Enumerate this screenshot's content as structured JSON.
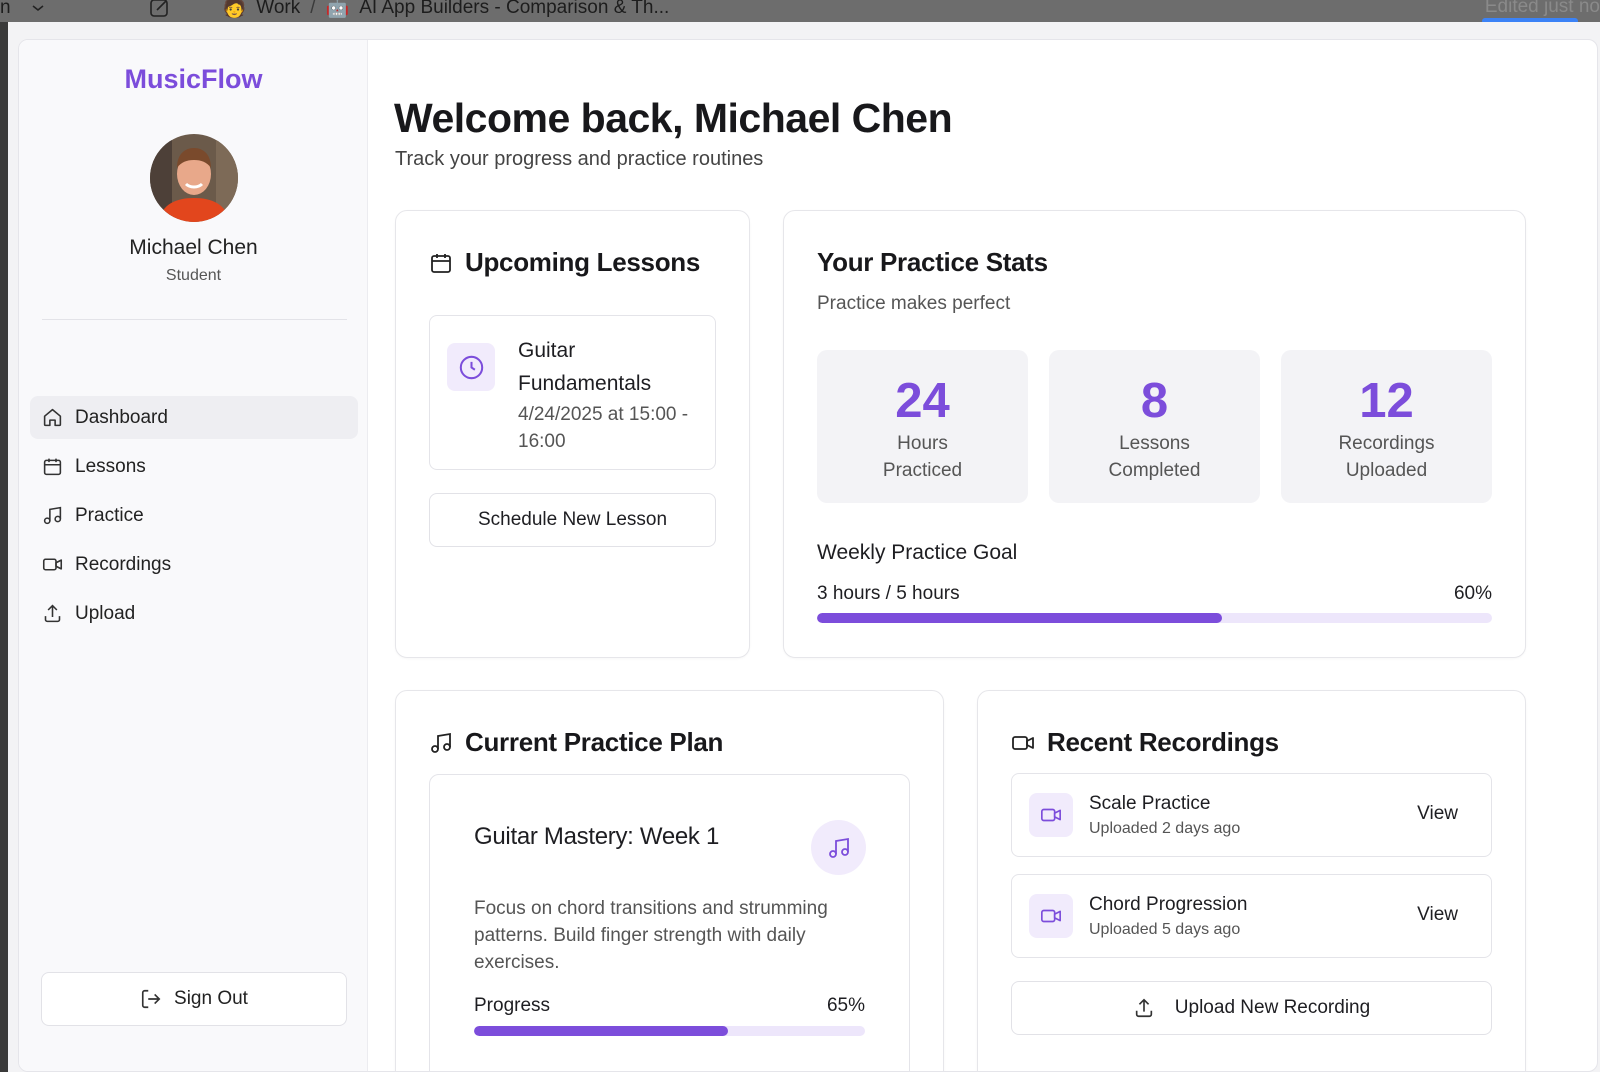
{
  "browser": {
    "tab_prefix": "n",
    "breadcrumb_workspace": "Work",
    "breadcrumb_separator": "/",
    "breadcrumb_page": "AI App Builders - Comparison & Th...",
    "status": "Edited just no"
  },
  "sidebar": {
    "logo": "MusicFlow",
    "user_name": "Michael Chen",
    "user_role": "Student",
    "nav": [
      {
        "label": "Dashboard",
        "icon": "home-icon",
        "active": true
      },
      {
        "label": "Lessons",
        "icon": "calendar-icon"
      },
      {
        "label": "Practice",
        "icon": "music-note-icon"
      },
      {
        "label": "Recordings",
        "icon": "video-icon"
      },
      {
        "label": "Upload",
        "icon": "upload-icon"
      }
    ],
    "sign_out_label": "Sign Out"
  },
  "header": {
    "title": "Welcome back, Michael Chen",
    "subtitle": "Track your progress and practice routines"
  },
  "upcoming_lessons": {
    "title": "Upcoming Lessons",
    "lesson": {
      "name": "Guitar Fundamentals",
      "time": "4/24/2025 at 15:00 - 16:00"
    },
    "schedule_button": "Schedule New Lesson"
  },
  "practice_stats": {
    "title": "Your Practice Stats",
    "subtitle": "Practice makes perfect",
    "stats": [
      {
        "value": "24",
        "label": "Hours Practiced"
      },
      {
        "value": "8",
        "label": "Lessons Completed"
      },
      {
        "value": "12",
        "label": "Recordings Uploaded"
      }
    ],
    "goal_title": "Weekly Practice Goal",
    "goal_text": "3 hours / 5 hours",
    "goal_percent_label": "60%",
    "goal_fraction": 0.6
  },
  "practice_plan": {
    "title": "Current Practice Plan",
    "plan_name": "Guitar Mastery: Week 1",
    "description": "Focus on chord transitions and strumming patterns. Build finger strength with daily exercises.",
    "progress_label": "Progress",
    "progress_percent_label": "65%",
    "progress_fraction": 0.65
  },
  "recent_recordings": {
    "title": "Recent Recordings",
    "items": [
      {
        "name": "Scale Practice",
        "meta": "Uploaded 2 days ago",
        "action": "View"
      },
      {
        "name": "Chord Progression",
        "meta": "Uploaded 5 days ago",
        "action": "View"
      }
    ],
    "upload_button": "Upload New Recording"
  },
  "colors": {
    "accent": "#7c4ddb",
    "accent_light": "#f1ebfc",
    "track": "#ede6fb"
  }
}
